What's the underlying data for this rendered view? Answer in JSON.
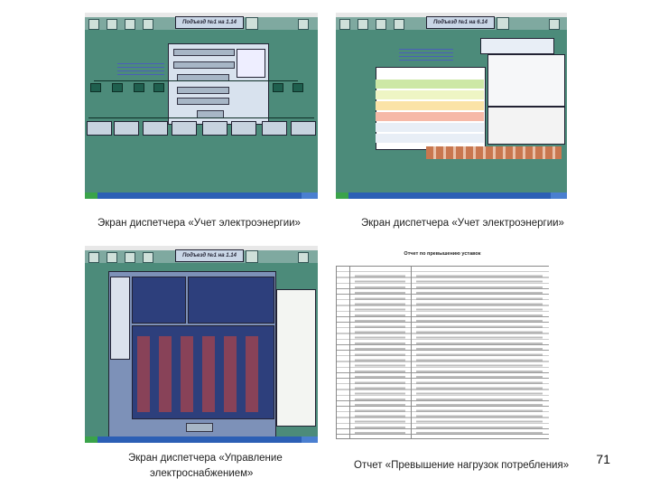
{
  "screens": {
    "top_left": {
      "title": "Подъезд №1 на 1.14"
    },
    "top_right": {
      "title": "Подъезд №1 на 6.14"
    },
    "bottom_left": {
      "title": "Подъезд №1 на 1.14"
    },
    "bottom_right": {
      "title": "Отчет по превышению уставок"
    }
  },
  "captions": {
    "top_left": "Экран диспетчера «Учет электроэнергии»",
    "top_right": "Экран диспетчера «Учет электроэнергии»",
    "bottom_left_line1": "Экран диспетчера «Управление",
    "bottom_left_line2": "электроснабжением»",
    "bottom_right": "Отчет «Превышение нагрузок потребления»"
  },
  "page_number": "71"
}
